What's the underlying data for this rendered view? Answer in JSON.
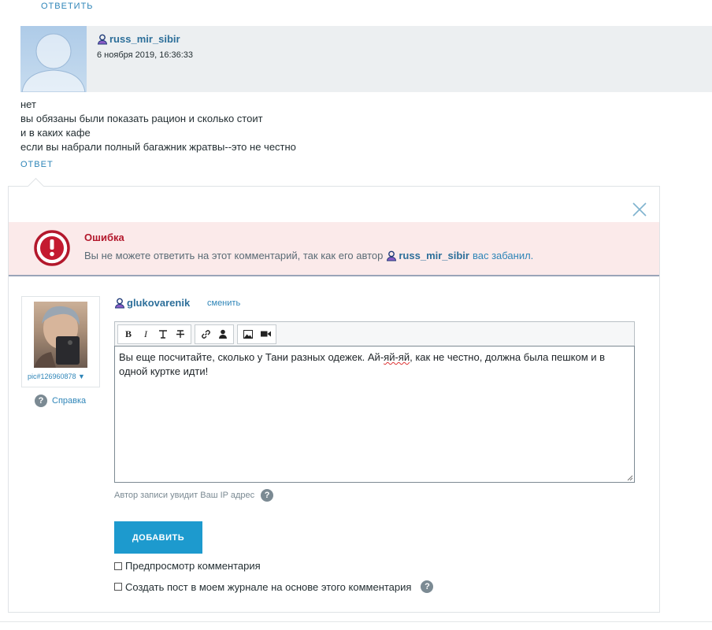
{
  "parent_reply_label": "ОТВЕТИТЬ",
  "comment": {
    "username": "russ_mir_sibir",
    "date": "6 ноября 2019, 16:36:33",
    "lines": [
      "нет",
      "вы обязаны были показать рацион и сколько стоит",
      "и в каких кафе",
      "если вы набрали полный багажник жратвы--это не честно"
    ],
    "reply_label": "ОТВЕТ"
  },
  "error": {
    "title": "Ошибка",
    "message": "Вы не можете ответить на этот комментарий, так как его автор",
    "author": "russ_mir_sibir",
    "tail": "вас забанил."
  },
  "form": {
    "userpic_label": "pic#126960878 ▼",
    "help_label": "Справка",
    "current_user": "glukovarenik",
    "change_label": "сменить",
    "editor_text_before": "Вы еще посчитайте, сколько у Тани разных одежек. Ай-",
    "editor_text_misspelled": "яй-яй",
    "editor_text_after": ", как не честно, должна была пешком и в одной куртке идти!",
    "ip_note": "Автор записи увидит Ваш IP адрес",
    "submit_label": "ДОБАВИТЬ",
    "preview_label": "Предпросмотр комментария",
    "create_post_label": "Создать пост в моем журнале на основе этого комментария"
  },
  "colors": {
    "link": "#2e85b8",
    "username": "#2d6f9a",
    "error_title": "#b3182c",
    "error_bg": "#fbeaea",
    "button": "#1d9ace"
  },
  "icons": [
    "user-icon",
    "close-icon",
    "error-icon",
    "bold-icon",
    "italic-icon",
    "text-style-icon",
    "strikethrough-icon",
    "link-icon",
    "user-tag-icon",
    "image-icon",
    "video-icon",
    "question-icon"
  ]
}
